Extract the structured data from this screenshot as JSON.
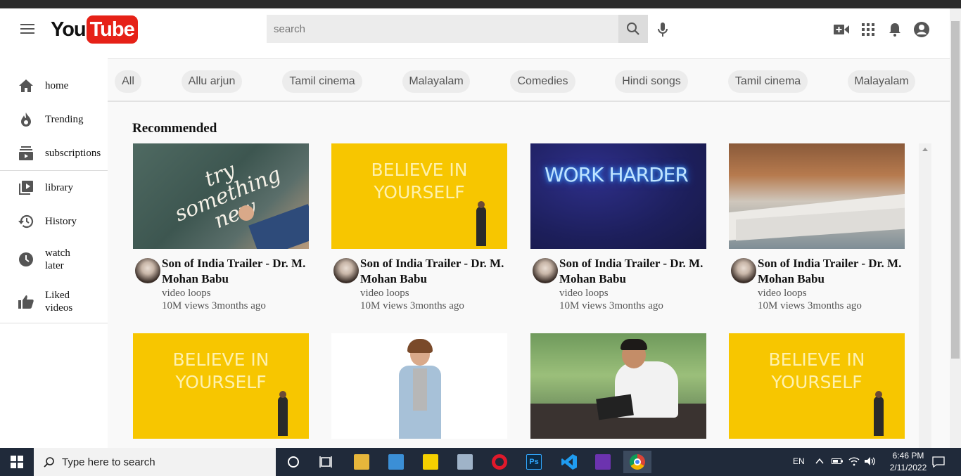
{
  "header": {
    "logo_you": "You",
    "logo_tube": "Tube",
    "search_placeholder": "search"
  },
  "sidebar": {
    "items": [
      {
        "label": "home",
        "icon": "home-icon"
      },
      {
        "label": "Trending",
        "icon": "fire-icon"
      },
      {
        "label": "subscriptions",
        "icon": "subscriptions-icon"
      },
      {
        "label": "library",
        "icon": "library-icon"
      },
      {
        "label": "History",
        "icon": "history-icon"
      },
      {
        "label": "watch later",
        "icon": "clock-icon"
      },
      {
        "label": "Liked videos",
        "icon": "thumbs-up-icon"
      }
    ]
  },
  "chips": [
    "All",
    "Allu arjun",
    "Tamil cinema",
    "Malayalam",
    "Comedies",
    "Hindi songs",
    "Tamil cinema",
    "Malayalam"
  ],
  "section_title": "Recommended",
  "videos": [
    {
      "title": "Son of India Trailer - Dr. M. Mohan Babu",
      "channel": "video loops",
      "meta": "10M views 3months ago",
      "thumb_text": "try something new"
    },
    {
      "title": "Son of India Trailer - Dr. M. Mohan Babu",
      "channel": "video loops",
      "meta": "10M views 3months ago",
      "thumb_text": "BELIEVE IN YOURSELF"
    },
    {
      "title": "Son of India Trailer - Dr. M. Mohan Babu",
      "channel": "video loops",
      "meta": "10M views 3months ago",
      "thumb_text": "WORK HARDER"
    },
    {
      "title": "Son of India Trailer - Dr. M. Mohan Babu",
      "channel": "video loops",
      "meta": "10M views 3months ago",
      "thumb_text": ""
    },
    {
      "thumb_text": "BELIEVE IN YOURSELF"
    },
    {
      "thumb_text": ""
    },
    {
      "thumb_text": ""
    },
    {
      "thumb_text": "BELIEVE IN YOURSELF"
    }
  ],
  "taskbar": {
    "search_text": "Type here to search",
    "language": "EN",
    "time": "6:46 PM",
    "date": "2/11/2022"
  },
  "colors": {
    "brand_red": "#e62117",
    "yellow_thumb": "#f7c600",
    "taskbar": "#202a3a"
  }
}
